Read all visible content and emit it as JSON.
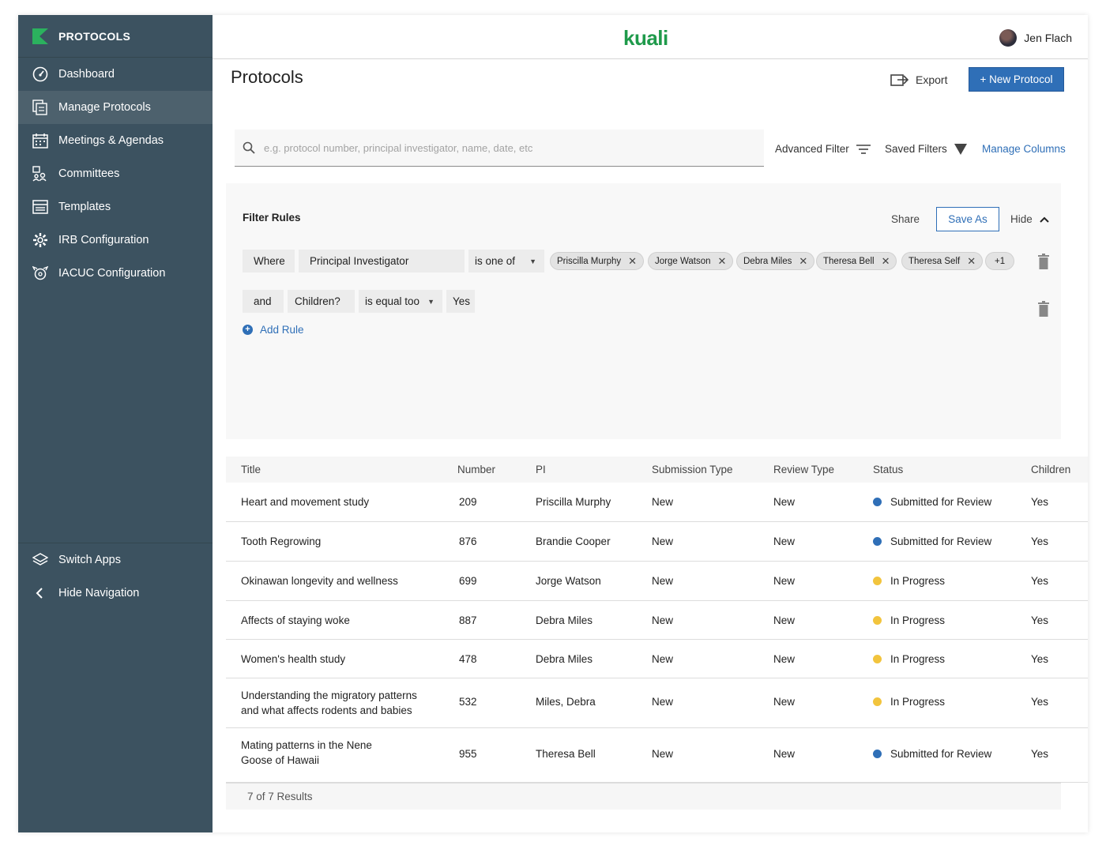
{
  "app": {
    "section_title": "PROTOCOLS",
    "brand": "kuali"
  },
  "sidebar": {
    "items": [
      {
        "label": "Dashboard",
        "icon": "dashboard-icon",
        "active": false
      },
      {
        "label": "Manage Protocols",
        "icon": "manage-protocols-icon",
        "active": true
      },
      {
        "label": "Meetings & Agendas",
        "icon": "calendar-icon",
        "active": false
      },
      {
        "label": "Committees",
        "icon": "committees-icon",
        "active": false
      },
      {
        "label": "Templates",
        "icon": "templates-icon",
        "active": false
      },
      {
        "label": "IRB Configuration",
        "icon": "gear-icon",
        "active": false
      },
      {
        "label": "IACUC Configuration",
        "icon": "animal-config-icon",
        "active": false
      }
    ],
    "bottom": [
      {
        "label": "Switch Apps",
        "icon": "layers-icon"
      },
      {
        "label": "Hide Navigation",
        "icon": "chevron-left-icon"
      }
    ]
  },
  "header": {
    "user_name": "Jen Flach"
  },
  "page": {
    "title": "Protocols",
    "export_label": "Export",
    "new_button_label": "+ New Protocol"
  },
  "search": {
    "placeholder": "e.g. protocol number, principal investigator, name, date, etc",
    "value": ""
  },
  "toolbar": {
    "advanced_filter": "Advanced Filter",
    "saved_filters": "Saved Filters",
    "manage_columns": "Manage Columns"
  },
  "filter": {
    "title": "Filter Rules",
    "share": "Share",
    "save_as": "Save As",
    "hide": "Hide",
    "rule1": {
      "connector": "Where",
      "field": "Principal Investigator",
      "operator": "is one of",
      "values": [
        "Priscilla Murphy",
        "Jorge Watson",
        "Debra Miles",
        "Theresa Bell",
        "Theresa Self"
      ],
      "more": "+1"
    },
    "rule2": {
      "connector": "and",
      "field": "Children?",
      "operator": "is equal too",
      "value": "Yes"
    },
    "add_rule": "Add Rule"
  },
  "table": {
    "columns": [
      "Title",
      "Number",
      "PI",
      "Submission Type",
      "Review Type",
      "Status",
      "Children"
    ],
    "status_colors": {
      "Submitted for Review": "#2f6fb7",
      "In Progress": "#f2c43d"
    },
    "rows": [
      {
        "title": [
          "Heart and movement study"
        ],
        "number": "209",
        "pi": "Priscilla Murphy",
        "submission": "New",
        "review": "New",
        "status": "Submitted for Review",
        "children": "Yes"
      },
      {
        "title": [
          "Tooth Regrowing"
        ],
        "number": "876",
        "pi": "Brandie Cooper",
        "submission": "New",
        "review": "New",
        "status": "Submitted for Review",
        "children": "Yes"
      },
      {
        "title": [
          "Okinawan longevity and wellness"
        ],
        "number": "699",
        "pi": "Jorge Watson",
        "submission": "New",
        "review": "New",
        "status": "In Progress",
        "children": "Yes"
      },
      {
        "title": [
          "Affects of staying woke"
        ],
        "number": "887",
        "pi": "Debra Miles",
        "submission": "New",
        "review": "New",
        "status": "In Progress",
        "children": "Yes"
      },
      {
        "title": [
          "Women's health study"
        ],
        "number": "478",
        "pi": "Debra Miles",
        "submission": "New",
        "review": "New",
        "status": "In Progress",
        "children": "Yes"
      },
      {
        "title": [
          "Understanding the migratory patterns",
          "and what affects rodents and babies"
        ],
        "number": "532",
        "pi": "Miles, Debra",
        "submission": "New",
        "review": "New",
        "status": "In Progress",
        "children": "Yes"
      },
      {
        "title": [
          "Mating patterns in the Nene",
          "Goose of Hawaii"
        ],
        "number": "955",
        "pi": "Theresa Bell",
        "submission": "New",
        "review": "New",
        "status": "Submitted for Review",
        "children": "Yes"
      }
    ],
    "results": "7 of 7 Results"
  }
}
